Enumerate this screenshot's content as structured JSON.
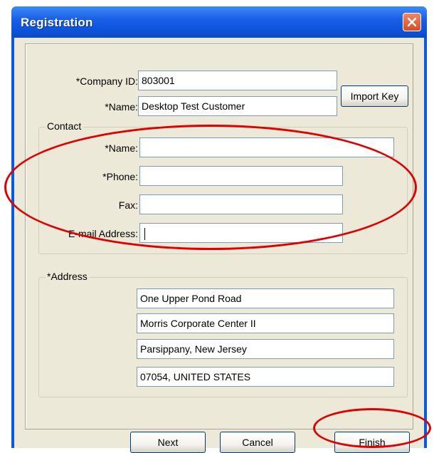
{
  "window": {
    "title": "Registration"
  },
  "form": {
    "company_id_label": "*Company ID:",
    "company_id_value": "803001",
    "name_label": "*Name:",
    "name_value": "Desktop Test Customer",
    "import_key_label": "Import Key"
  },
  "contact": {
    "legend": "Contact",
    "name_label": "*Name:",
    "name_value": "",
    "phone_label": "*Phone:",
    "phone_value": "",
    "fax_label": "Fax:",
    "fax_value": "",
    "email_label": "E-mail Address:",
    "email_value": ""
  },
  "address": {
    "legend": "*Address",
    "lines": [
      "One Upper Pond Road",
      "Morris Corporate Center II",
      "Parsippany, New Jersey",
      "07054, UNITED STATES"
    ]
  },
  "buttons": {
    "next": "Next",
    "cancel": "Cancel",
    "finish": "Finish"
  },
  "annotations": {
    "highlight_color": "#e00000"
  }
}
